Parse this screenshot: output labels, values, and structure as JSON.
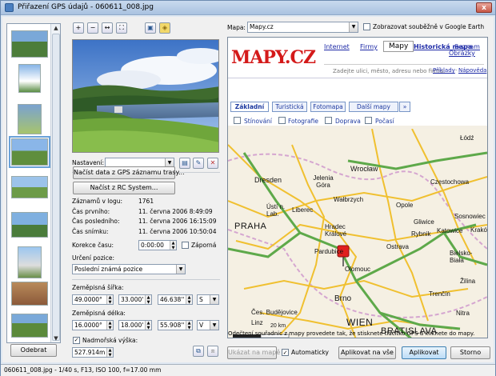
{
  "window": {
    "title": "Přiřazení GPS údajů - 060611_008.jpg",
    "close": "x"
  },
  "toolbar": {
    "zoom_in": "+",
    "zoom_out": "−",
    "zoom_fit": "↔",
    "zoom_full": "⛶",
    "photo_view": "▣",
    "gps_view": "◈"
  },
  "thumbnails": {
    "remove_button": "Odebrat",
    "count": 8,
    "selected_index": 3
  },
  "left": {
    "nastaveni_label": "Nastavení:",
    "nastaveni_value": "",
    "gps_button": "Načíst data z GPS záznamu trasy...",
    "rc_button": "Načíst z RC System...",
    "stats": [
      {
        "label": "Záznamů v logu:",
        "value": "1761"
      },
      {
        "label": "Čas prvního:",
        "value": "11. června 2006 8:49:09"
      },
      {
        "label": "Čas posledního:",
        "value": "11. června 2006 16:15:09"
      },
      {
        "label": "Čas snímku:",
        "value": "11. června 2006 10:50:04"
      }
    ],
    "korekce_label": "Korekce času:",
    "korekce_value": "0:00:00",
    "zaporna_label": "Záporná",
    "urceni_label": "Určení pozice:",
    "urceni_value": "Poslední známá pozice",
    "sirka_label": "Zeměpisná šířka:",
    "sirka": [
      "49.0000°",
      "33.000'",
      "46.638''",
      "S"
    ],
    "delka_label": "Zeměpisná délka:",
    "delka": [
      "16.0000°",
      "18.000'",
      "55.908''",
      "V"
    ],
    "vyska_label": "Nadmořská výška:",
    "vyska_checked": "✓",
    "vyska_value": "527.914m"
  },
  "map": {
    "label": "Mapa:",
    "selected": "Mapy.cz",
    "google_earth_label": "Zobrazovat souběžně v Google Earth",
    "logo": "MAPY.CZ",
    "links": [
      "Internet",
      "Firmy",
      "Mapy",
      "Historická mapa",
      "Seznam",
      "Obrázky"
    ],
    "search_hint": "Zadejte ulici, město, adresu nebo firmu.",
    "examples": "Příklady",
    "help": "Nápověda",
    "tabs": [
      "Základní",
      "Turistická",
      "Fotomapa",
      "Další mapy"
    ],
    "layers": [
      "Stínování",
      "Fotografie",
      "Doprava",
      "Počasí"
    ],
    "cities": [
      "Łódź",
      "Wrocław",
      "Częstochowa",
      "Dresden",
      "Jelenia Góra",
      "Wałbrzych",
      "Opole",
      "Ústí n. Lab.",
      "Liberec",
      "Katowice",
      "Sosnowiec",
      "Kraków",
      "Hradec Králové",
      "Gliwice",
      "Rybnik",
      "Pardubice",
      "Ostrava",
      "Bielsko-Biała",
      "Olomouc",
      "Brno",
      "Čes. Budějovice",
      "Linz",
      "Trenčín",
      "Žilina",
      "Nitra"
    ],
    "big_cities": [
      "PRAHA",
      "WIEN",
      "BRATISLAVA"
    ],
    "scale": "20 km",
    "hint": "Odečtení souřadnic z mapy provedete tak, že stisknete tlačítko GPS a kliknete do mapy."
  },
  "bottom": {
    "show_on_map": "Ukázat na mapě",
    "auto_label": "Automaticky",
    "apply_all": "Aplikovat na vše",
    "apply": "Aplikovat",
    "cancel": "Storno"
  },
  "status": "060611_008.jpg - 1/40 s, F13, ISO 100, f=17.00 mm",
  "colors": {
    "title_bg": "#b8cde6",
    "map_road": "#f0c030",
    "map_highway": "#5ea94a",
    "marker": "#e0201e"
  }
}
